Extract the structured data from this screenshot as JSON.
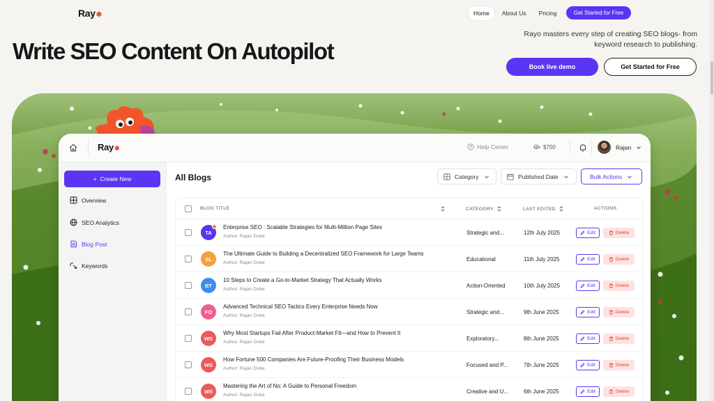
{
  "nav": {
    "logo": "Ray",
    "links": [
      {
        "label": "Home",
        "active": true
      },
      {
        "label": "About Us",
        "active": false
      },
      {
        "label": "Pricing",
        "active": false
      }
    ],
    "cta": "Get Started for Free"
  },
  "hero": {
    "title": "Write SEO Content On Autopilot",
    "description": "Rayo masters every step of creating SEO blogs- from keyword research to publishing.",
    "demo_button": "Book live demo",
    "free_button": "Get Started for Free"
  },
  "app": {
    "logo": "Ray",
    "help_center": "Help Center",
    "credits": "$700",
    "user_name": "Rajan",
    "sidebar": {
      "create_new": "Create New",
      "items": [
        {
          "label": "Overview",
          "icon": "grid-icon",
          "active": false
        },
        {
          "label": "SEO Analytics",
          "icon": "globe-icon",
          "active": false
        },
        {
          "label": "Blog Post",
          "icon": "document-icon",
          "active": true
        },
        {
          "label": "Keywords",
          "icon": "keyword-icon",
          "active": false
        }
      ]
    },
    "main": {
      "title": "All Blogs",
      "filters": {
        "category": "Category",
        "published_date": "Published Date",
        "bulk_actions": "Bulk Actions"
      },
      "table": {
        "headers": {
          "title": "BLOG TITLE",
          "category": "CATEGORY",
          "last_edited": "LAST EDITED",
          "actions": "ACTIONS"
        },
        "edit_label": "Edit",
        "delete_label": "Delete",
        "rows": [
          {
            "initials": "TA",
            "color": "#5b35f2",
            "badge": true,
            "title": "Enterprise SEO : Scalable Strategies for Multi-Million Page Sites",
            "author": "Author: Rajan Dube",
            "category": "Strategic and...",
            "date": "12th July 2025"
          },
          {
            "initials": "SL",
            "color": "#f5a13a",
            "badge": false,
            "title": "The Ultimate Guide to Building a Decentralized SEO Framework for Large Teams",
            "author": "Author: Rajan Dube",
            "category": "Educational",
            "date": "11th July 2025"
          },
          {
            "initials": "BT",
            "color": "#3b8ef0",
            "badge": false,
            "title": "10 Steps to Create a Go-to-Market Strategy That Actually Works",
            "author": "Author: Rajan Dube",
            "category": "Action-Oriented",
            "date": "10th July 2025"
          },
          {
            "initials": "FO",
            "color": "#ef5f8e",
            "badge": false,
            "title": "Advanced Technical SEO Tactics Every Enterprise Needs Now",
            "author": "Author: Rajan Dube",
            "category": "Strategic and...",
            "date": "9th June 2025"
          },
          {
            "initials": "WS",
            "color": "#ec5a5a",
            "badge": false,
            "title": "Why Most Startups Fail After Product-Market Fit—and How to Prevent It",
            "author": "Author: Rajan Dube",
            "category": "Exploratory...",
            "date": "8th June 2025"
          },
          {
            "initials": "WS",
            "color": "#ec5a5a",
            "badge": false,
            "title": "How Fortune 500 Companies Are Future-Proofing Their Business Models",
            "author": "Author: Rajan Dube",
            "category": "Focused and P...",
            "date": "7th June 2025"
          },
          {
            "initials": "WS",
            "color": "#ec5a5a",
            "badge": false,
            "title": "Mastering the Art of No: A Guide to Personal Freedom",
            "author": "Author: Rajan Dube",
            "category": "Creative and U...",
            "date": "6th June 2025"
          }
        ]
      }
    }
  },
  "colors": {
    "accent": "#5b35f2",
    "danger": "#e0463c",
    "grass": "#4f8223"
  }
}
